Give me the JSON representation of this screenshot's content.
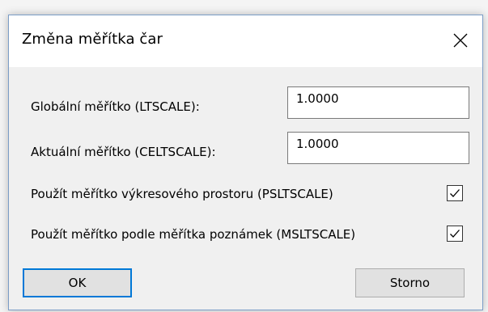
{
  "window": {
    "title": "Změna měřítka čar",
    "close_icon": "close-icon"
  },
  "fields": {
    "global_scale": {
      "label": "Globální měřítko (LTSCALE):",
      "value": "1.0000"
    },
    "current_scale": {
      "label": "Aktuální měřítko (CELTSCALE):",
      "value": "1.0000"
    }
  },
  "checkboxes": {
    "psltscale": {
      "label": "Použít měřítko výkresového prostoru (PSLTSCALE)",
      "checked": true
    },
    "msltscale": {
      "label": "Použít měřítko podle měřítka poznámek (MSLTSCALE)",
      "checked": true
    }
  },
  "buttons": {
    "ok_label": "OK",
    "cancel_label": "Storno"
  },
  "colors": {
    "accent": "#0078d7",
    "window_border": "#7a9cc6",
    "body": "#f0f0f0"
  }
}
